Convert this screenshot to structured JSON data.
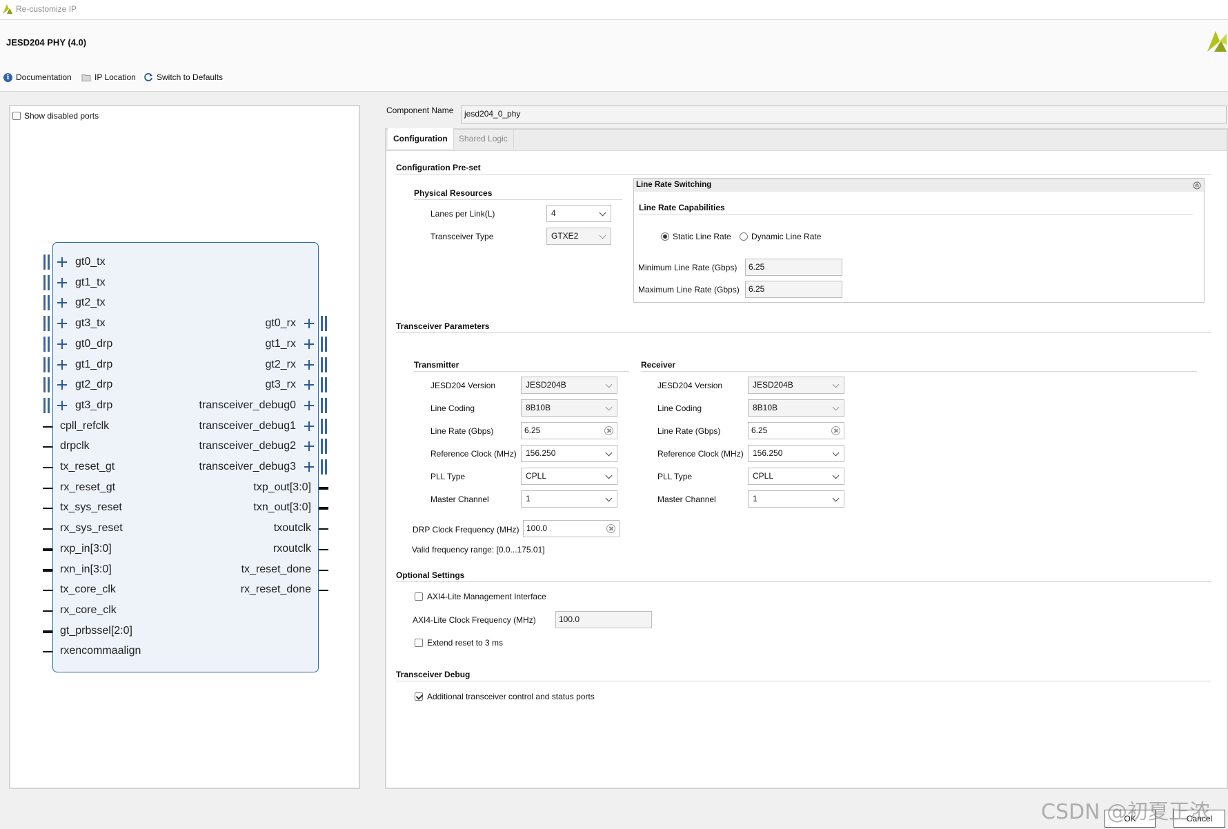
{
  "window": {
    "title": "Re-customize IP"
  },
  "header": {
    "title": "JESD204 PHY (4.0)"
  },
  "toolbar": {
    "documentation": "Documentation",
    "ip_location": "IP Location",
    "switch_defaults": "Switch to Defaults"
  },
  "left": {
    "show_disabled_ports": "Show disabled ports",
    "left_ports": [
      "gt0_tx",
      "gt1_tx",
      "gt2_tx",
      "gt3_tx",
      "gt0_drp",
      "gt1_drp",
      "gt2_drp",
      "gt3_drp",
      "cpll_refclk",
      "drpclk",
      "tx_reset_gt",
      "rx_reset_gt",
      "tx_sys_reset",
      "rx_sys_reset",
      "rxp_in[3:0]",
      "rxn_in[3:0]",
      "tx_core_clk",
      "rx_core_clk",
      "gt_prbssel[2:0]",
      "rxencommaalign"
    ],
    "right_ports": [
      "gt0_rx",
      "gt1_rx",
      "gt2_rx",
      "gt3_rx",
      "transceiver_debug0",
      "transceiver_debug1",
      "transceiver_debug2",
      "transceiver_debug3",
      "txp_out[3:0]",
      "txn_out[3:0]",
      "txoutclk",
      "rxoutclk",
      "tx_reset_done",
      "rx_reset_done"
    ]
  },
  "component": {
    "label": "Component Name",
    "value": "jesd204_0_phy"
  },
  "tabs": {
    "configuration": "Configuration",
    "shared_logic": "Shared Logic"
  },
  "config": {
    "preset_title": "Configuration Pre-set",
    "physical_title": "Physical Resources",
    "lanes_label": "Lanes per Link(L)",
    "lanes_value": "4",
    "transceiver_label": "Transceiver Type",
    "transceiver_value": "GTXE2",
    "line_rate_switching": "Line Rate Switching",
    "line_rate_capabilities": "Line Rate Capabilities",
    "static_line_rate": "Static Line Rate",
    "dynamic_line_rate": "Dynamic Line Rate",
    "min_rate_label": "Minimum Line Rate (Gbps)",
    "min_rate_value": "6.25",
    "max_rate_label": "Maximum Line Rate (Gbps)",
    "max_rate_value": "6.25",
    "transceiver_params": "Transceiver Parameters",
    "transmitter": "Transmitter",
    "receiver": "Receiver",
    "jesd_version_label": "JESD204 Version",
    "jesd_version_value": "JESD204B",
    "line_coding_label": "Line Coding",
    "line_coding_value": "8B10B",
    "line_rate_label": "Line Rate (Gbps)",
    "line_rate_value": "6.25",
    "ref_clock_label": "Reference Clock (MHz)",
    "ref_clock_value": "156.250",
    "pll_type_label": "PLL Type",
    "pll_type_value": "CPLL",
    "master_channel_label": "Master Channel",
    "master_channel_value": "1",
    "drp_freq_label": "DRP Clock Frequency (MHz)",
    "drp_freq_value": "100.0",
    "valid_range": "Valid frequency range: [0.0...175.01]",
    "optional_settings": "Optional Settings",
    "axi_lite_mgmt": "AXI4-Lite Management Interface",
    "axi_lite_freq_label": "AXI4-Lite Clock Frequency (MHz)",
    "axi_lite_freq_value": "100.0",
    "extend_reset": "Extend reset to 3 ms",
    "transceiver_debug": "Transceiver Debug",
    "additional_ports": "Additional transceiver control and status ports"
  },
  "buttons": {
    "ok": "OK",
    "cancel": "Cancel"
  },
  "watermark": "CSDN @初夏正浓",
  "colors": {
    "accent": "#2c6aa8",
    "block_fill": "#eef3fa",
    "logo": "#b5c21a"
  }
}
